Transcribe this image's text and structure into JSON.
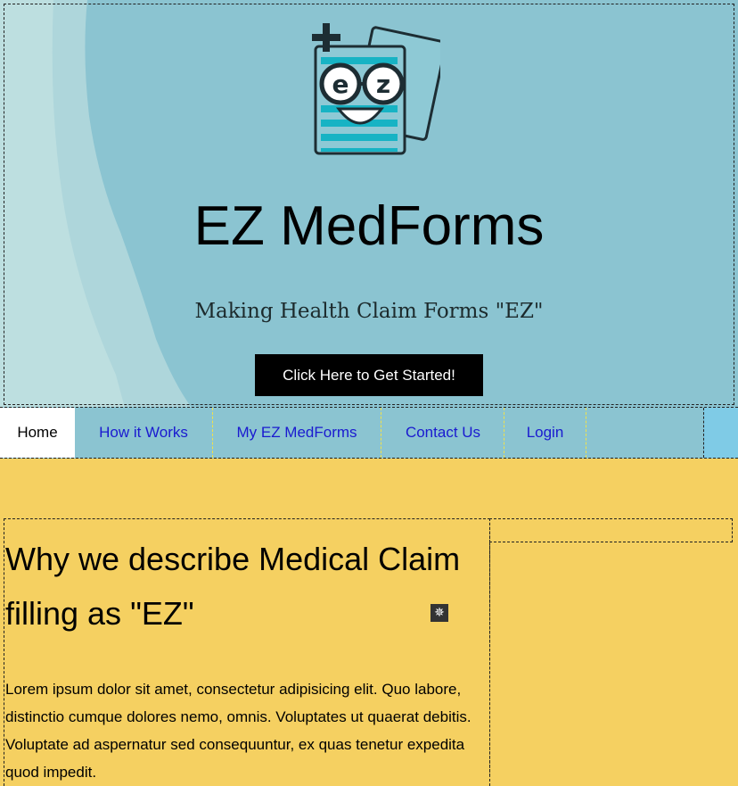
{
  "hero": {
    "title": "EZ MedForms",
    "tagline": "Making Health Claim Forms \"EZ\"",
    "cta_label": "Click Here to Get Started!"
  },
  "nav": {
    "items": [
      {
        "label": "Home",
        "active": true
      },
      {
        "label": "How it Works"
      },
      {
        "label": "My EZ MedForms"
      },
      {
        "label": "Contact Us"
      },
      {
        "label": "Login"
      }
    ]
  },
  "content": {
    "heading": "Why we describe Medical Claim filling as \"EZ\"",
    "body": "Lorem ipsum dolor sit amet, consectetur adipisicing elit. Quo labore, distinctio cumque dolores nemo, omnis. Voluptates ut quaerat debitis. Voluptate ad aspernatur sed consequuntur, ex quas tenetur expedita quod impedit."
  },
  "colors": {
    "hero_bg": "#8bc4d1",
    "page_bg": "#f5d061",
    "nav_link": "#1a1ad0",
    "cta_bg": "#000000",
    "logo_teal": "#17b3c4"
  },
  "icons": {
    "logo": "ez-forms-logo",
    "widget": "settings-gear-icon"
  }
}
